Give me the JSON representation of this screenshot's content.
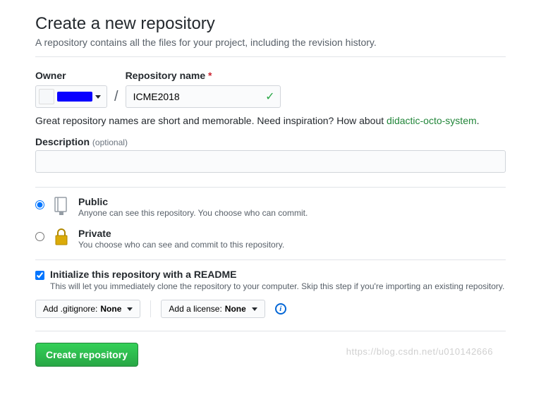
{
  "header": {
    "title": "Create a new repository",
    "subtitle": "A repository contains all the files for your project, including the revision history."
  },
  "owner": {
    "label": "Owner"
  },
  "repo": {
    "label": "Repository name",
    "required": "*",
    "value": "ICME2018"
  },
  "hint": {
    "prefix": "Great repository names are short and memorable. Need inspiration? How about ",
    "suggestion": "didactic-octo-system",
    "suffix": "."
  },
  "description": {
    "label": "Description",
    "optional": "(optional)",
    "value": ""
  },
  "visibility": {
    "public": {
      "title": "Public",
      "sub": "Anyone can see this repository. You choose who can commit."
    },
    "private": {
      "title": "Private",
      "sub": "You choose who can see and commit to this repository."
    }
  },
  "readme": {
    "title": "Initialize this repository with a README",
    "sub": "This will let you immediately clone the repository to your computer. Skip this step if you're importing an existing repository."
  },
  "gitignore": {
    "prefix": "Add .gitignore: ",
    "value": "None"
  },
  "license": {
    "prefix": "Add a license: ",
    "value": "None"
  },
  "submit": {
    "label": "Create repository"
  },
  "watermark": "https://blog.csdn.net/u010142666"
}
